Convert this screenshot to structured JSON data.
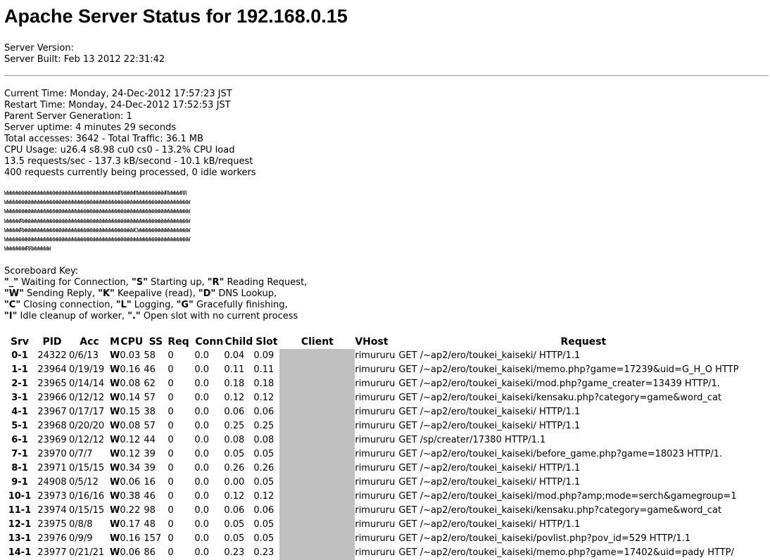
{
  "page_title": "Apache Server Status for 192.168.0.15",
  "server": {
    "version_line": "Server Version:",
    "built_line": "Server Built: Feb 13 2012 22:31:42"
  },
  "stats": [
    "Current Time: Monday, 24-Dec-2012 17:57:23 JST",
    "Restart Time: Monday, 24-Dec-2012 17:52:53 JST",
    "Parent Server Generation: 1",
    "Server uptime: 4 minutes 29 seconds",
    "Total accesses: 3642 - Total Traffic: 36.1 MB",
    "CPU Usage: u26.4 s8.98 cu0 cs0 - 13.2% CPU load",
    "13.5 requests/sec - 137.3 kB/second - 10.1 kB/request",
    "400 requests currently being processed, 0 idle workers"
  ],
  "scoreboard": [
    "WWWWWWWWWWWWWWWWWWWWWWWWWWWWWWWWWWWWWRWWWWRWWWWWWWWWRWWWWRR",
    "WWWWWWWWWWWWWWWWWWWWWWWWWWWWWWWWWWWWWWWWWWWWWWWWWWWWWWWWWWWW",
    "WWWWWWWWWWWWWWWWWWWWWWWWWWWWWWWWWWWWWWWWWWWWWWWWWWWWWWWWWWWW",
    "WWWWWRWWWWWWWWWWWWWWWWWWWWWWWWWWWWWWWWWWWWWWWWWWWWWWWWWWWWWW",
    "WWWWWRWWWWWWWWWWWWWWWWWWWWWWWWWWWWWWWWWWWWCWWWWWWWWWWWWWWWWW",
    "WWWWWWWWWWWWWWWWWWWWWWWWWWWWWWWWWWWWWWWWWWWWWWWWWWWWWWWWWWWW",
    "WWWWWWWRRWWWWWW"
  ],
  "scoreboard_key": {
    "heading": "Scoreboard Key:",
    "lines": [
      [
        {
          "k": "\"_\"",
          "d": " Waiting for Connection, "
        },
        {
          "k": "\"S\"",
          "d": " Starting up, "
        },
        {
          "k": "\"R\"",
          "d": " Reading Request,"
        }
      ],
      [
        {
          "k": "\"W\"",
          "d": " Sending Reply, "
        },
        {
          "k": "\"K\"",
          "d": " Keepalive (read), "
        },
        {
          "k": "\"D\"",
          "d": " DNS Lookup,"
        }
      ],
      [
        {
          "k": "\"C\"",
          "d": " Closing connection, "
        },
        {
          "k": "\"L\"",
          "d": " Logging, "
        },
        {
          "k": "\"G\"",
          "d": " Gracefully finishing,"
        }
      ],
      [
        {
          "k": "\"I\"",
          "d": " Idle cleanup of worker, "
        },
        {
          "k": "\".\"",
          "d": " Open slot with no current process"
        }
      ]
    ]
  },
  "table": {
    "headers": [
      "Srv",
      "PID",
      "Acc",
      "M",
      "CPU",
      "SS",
      "Req",
      "Conn",
      "Child",
      "Slot",
      "Client",
      "VHost",
      "Request"
    ],
    "rows": [
      [
        "0-1",
        "24322",
        "0/6/13",
        "W",
        "0.03",
        "58",
        "0",
        "0.0",
        "0.04",
        "0.09",
        "",
        "rimururu",
        "GET /~ap2/ero/toukei_kaiseki/ HTTP/1.1"
      ],
      [
        "1-1",
        "23964",
        "0/19/19",
        "W",
        "0.16",
        "46",
        "0",
        "0.0",
        "0.11",
        "0.11",
        "",
        "rimururu",
        "GET /~ap2/ero/toukei_kaiseki/memo.php?game=17239&uid=G_H_O HTTP"
      ],
      [
        "2-1",
        "23965",
        "0/14/14",
        "W",
        "0.08",
        "62",
        "0",
        "0.0",
        "0.18",
        "0.18",
        "",
        "rimururu",
        "GET /~ap2/ero/toukei_kaiseki/mod.php?game_creater=13439 HTTP/1."
      ],
      [
        "3-1",
        "23966",
        "0/12/12",
        "W",
        "0.14",
        "57",
        "0",
        "0.0",
        "0.12",
        "0.12",
        "",
        "rimururu",
        "GET /~ap2/ero/toukei_kaiseki/kensaku.php?category=game&word_cat"
      ],
      [
        "4-1",
        "23967",
        "0/17/17",
        "W",
        "0.15",
        "38",
        "0",
        "0.0",
        "0.06",
        "0.06",
        "",
        "rimururu",
        "GET /~ap2/ero/toukei_kaiseki/ HTTP/1.1"
      ],
      [
        "5-1",
        "23968",
        "0/20/20",
        "W",
        "0.08",
        "57",
        "0",
        "0.0",
        "0.25",
        "0.25",
        "",
        "rimururu",
        "GET /~ap2/ero/toukei_kaiseki/ HTTP/1.1"
      ],
      [
        "6-1",
        "23969",
        "0/12/12",
        "W",
        "0.12",
        "44",
        "0",
        "0.0",
        "0.08",
        "0.08",
        "",
        "rimururu",
        "GET /sp/creater/17380 HTTP/1.1"
      ],
      [
        "7-1",
        "23970",
        "0/7/7",
        "W",
        "0.12",
        "39",
        "0",
        "0.0",
        "0.05",
        "0.05",
        "",
        "rimururu",
        "GET /~ap2/ero/toukei_kaiseki/before_game.php?game=18023 HTTP/1."
      ],
      [
        "8-1",
        "23971",
        "0/15/15",
        "W",
        "0.34",
        "39",
        "0",
        "0.0",
        "0.26",
        "0.26",
        "",
        "rimururu",
        "GET /~ap2/ero/toukei_kaiseki/ HTTP/1.1"
      ],
      [
        "9-1",
        "24908",
        "0/5/12",
        "W",
        "0.06",
        "16",
        "0",
        "0.0",
        "0.00",
        "0.05",
        "",
        "rimururu",
        "GET /~ap2/ero/toukei_kaiseki/ HTTP/1.1"
      ],
      [
        "10-1",
        "23973",
        "0/16/16",
        "W",
        "0.38",
        "46",
        "0",
        "0.0",
        "0.12",
        "0.12",
        "",
        "rimururu",
        "GET /~ap2/ero/toukei_kaiseki/mod.php?amp;mode=serch&gamegroup=1"
      ],
      [
        "11-1",
        "23974",
        "0/15/15",
        "W",
        "0.22",
        "98",
        "0",
        "0.0",
        "0.06",
        "0.06",
        "",
        "rimururu",
        "GET /~ap2/ero/toukei_kaiseki/kensaku.php?category=game&word_cat"
      ],
      [
        "12-1",
        "23975",
        "0/8/8",
        "W",
        "0.17",
        "48",
        "0",
        "0.0",
        "0.05",
        "0.05",
        "",
        "rimururu",
        "GET /~ap2/ero/toukei_kaiseki/ HTTP/1.1"
      ],
      [
        "13-1",
        "23976",
        "0/9/9",
        "W",
        "0.16",
        "157",
        "0",
        "0.0",
        "0.05",
        "0.05",
        "",
        "rimururu",
        "GET /~ap2/ero/toukei_kaiseki/povlist.php?pov_id=529 HTTP/1.1"
      ],
      [
        "14-1",
        "23977",
        "0/21/21",
        "W",
        "0.06",
        "86",
        "0",
        "0.0",
        "0.23",
        "0.23",
        "",
        "rimururu",
        "GET /~ap2/ero/toukei_kaiseki/memo.php?game=17402&uid=pady HTTP/"
      ]
    ]
  }
}
